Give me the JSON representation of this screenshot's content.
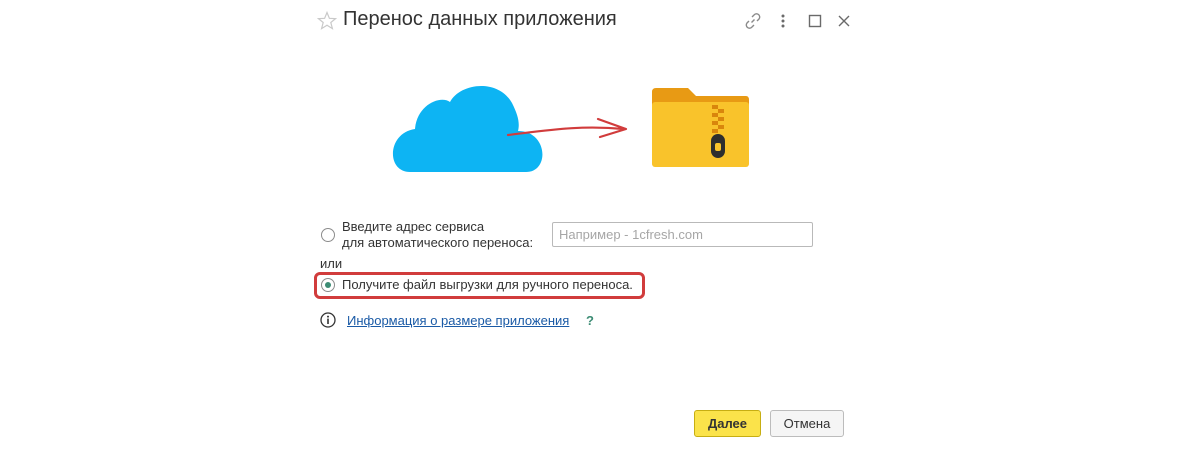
{
  "window": {
    "title": "Перенос данных приложения",
    "icons": [
      "star-icon",
      "link-icon",
      "more-icon",
      "maximize-icon",
      "close-icon"
    ]
  },
  "illustration": {
    "icons": [
      "cloud-icon",
      "arrow-icon",
      "zip-folder-icon"
    ],
    "colors": {
      "cloud": "#0db4f3",
      "arrow": "#d13c3c",
      "folder": "#f9c32b",
      "folder_tab": "#e89a14"
    }
  },
  "options": {
    "auto": {
      "line1": "Введите адрес сервиса",
      "line2": "для автоматического переноса:",
      "input_placeholder": "Например - 1cfresh.com",
      "input_value": "",
      "selected": false
    },
    "or_label": "или",
    "manual": {
      "label": "Получите файл выгрузки для ручного переноса.",
      "selected": true
    }
  },
  "info": {
    "link_text": "Информация о размере приложения",
    "help_text": "?"
  },
  "buttons": {
    "next_label": "Далее",
    "cancel_label": "Отмена"
  },
  "colors": {
    "highlight": "#d13c3c",
    "primary_button": "#fbe34a",
    "link": "#1a5aa6",
    "accent": "#3c8c74"
  }
}
